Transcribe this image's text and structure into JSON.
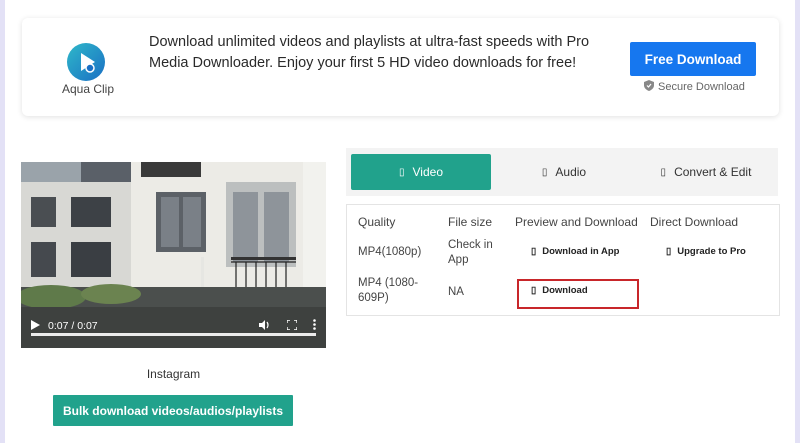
{
  "banner": {
    "app_name": "Aqua Clip",
    "description": "Download unlimited videos and playlists at ultra-fast speeds with Pro Media Downloader. Enjoy your first 5 HD video downloads for free!",
    "cta_label": "Free Download",
    "secure_label": "Secure Download"
  },
  "video": {
    "time_display": "0:07 / 0:07",
    "caption": "Instagram"
  },
  "bulk_button": "Bulk download videos/audios/playlists",
  "tabs": [
    {
      "label": "Video",
      "active": true
    },
    {
      "label": "Audio",
      "active": false
    },
    {
      "label": "Convert & Edit",
      "active": false
    }
  ],
  "table": {
    "headers": [
      "Quality",
      "File size",
      "Preview and Download",
      "Direct Download"
    ],
    "rows": [
      {
        "quality": "MP4(1080p)",
        "size": "Check in App",
        "preview": "Download in App",
        "direct": "Upgrade to Pro"
      },
      {
        "quality": "MP4 (1080-609P)",
        "size": "NA",
        "preview": "Download",
        "direct": ""
      }
    ]
  },
  "colors": {
    "accent_green": "#21a28c",
    "cta_blue": "#1677ef",
    "highlight_red": "#c8262a"
  }
}
